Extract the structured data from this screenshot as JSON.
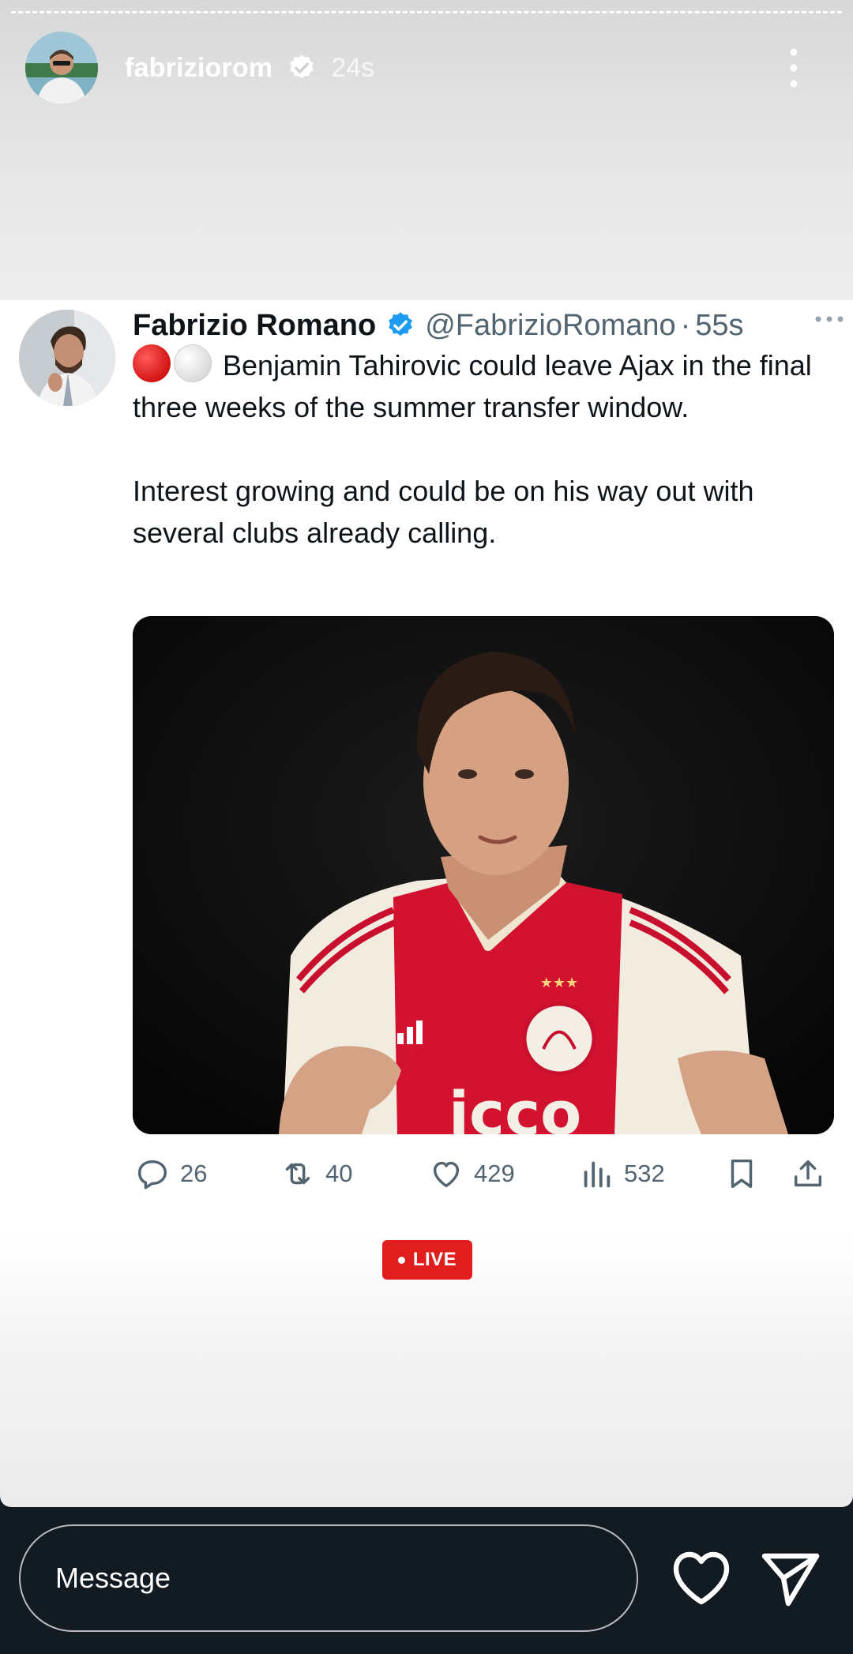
{
  "story": {
    "username": "fabriziorom",
    "time_ago": "24s"
  },
  "tweet": {
    "name": "Fabrizio Romano",
    "handle": "@FabrizioRomano",
    "separator": "·",
    "time": "55s",
    "text_line1": "Benjamin Tahirovic could leave Ajax in the final three weeks of the summer transfer window.",
    "text_line2": "Interest growing and could be on his way out with several clubs already calling.",
    "image_text": "icco",
    "stats": {
      "replies": "26",
      "retweets": "40",
      "likes": "429",
      "views": "532"
    }
  },
  "live_label": "LIVE",
  "message": {
    "placeholder": "Message"
  },
  "colors": {
    "verified_blue": "#1d9bf0",
    "live_red": "#e01e1e",
    "ajax_red": "#d2122e"
  },
  "icons": [
    "verified-icon",
    "more-vertical-icon",
    "more-horizontal-icon",
    "reply-icon",
    "retweet-icon",
    "like-icon",
    "views-icon",
    "bookmark-icon",
    "share-icon",
    "heart-icon",
    "send-icon"
  ]
}
